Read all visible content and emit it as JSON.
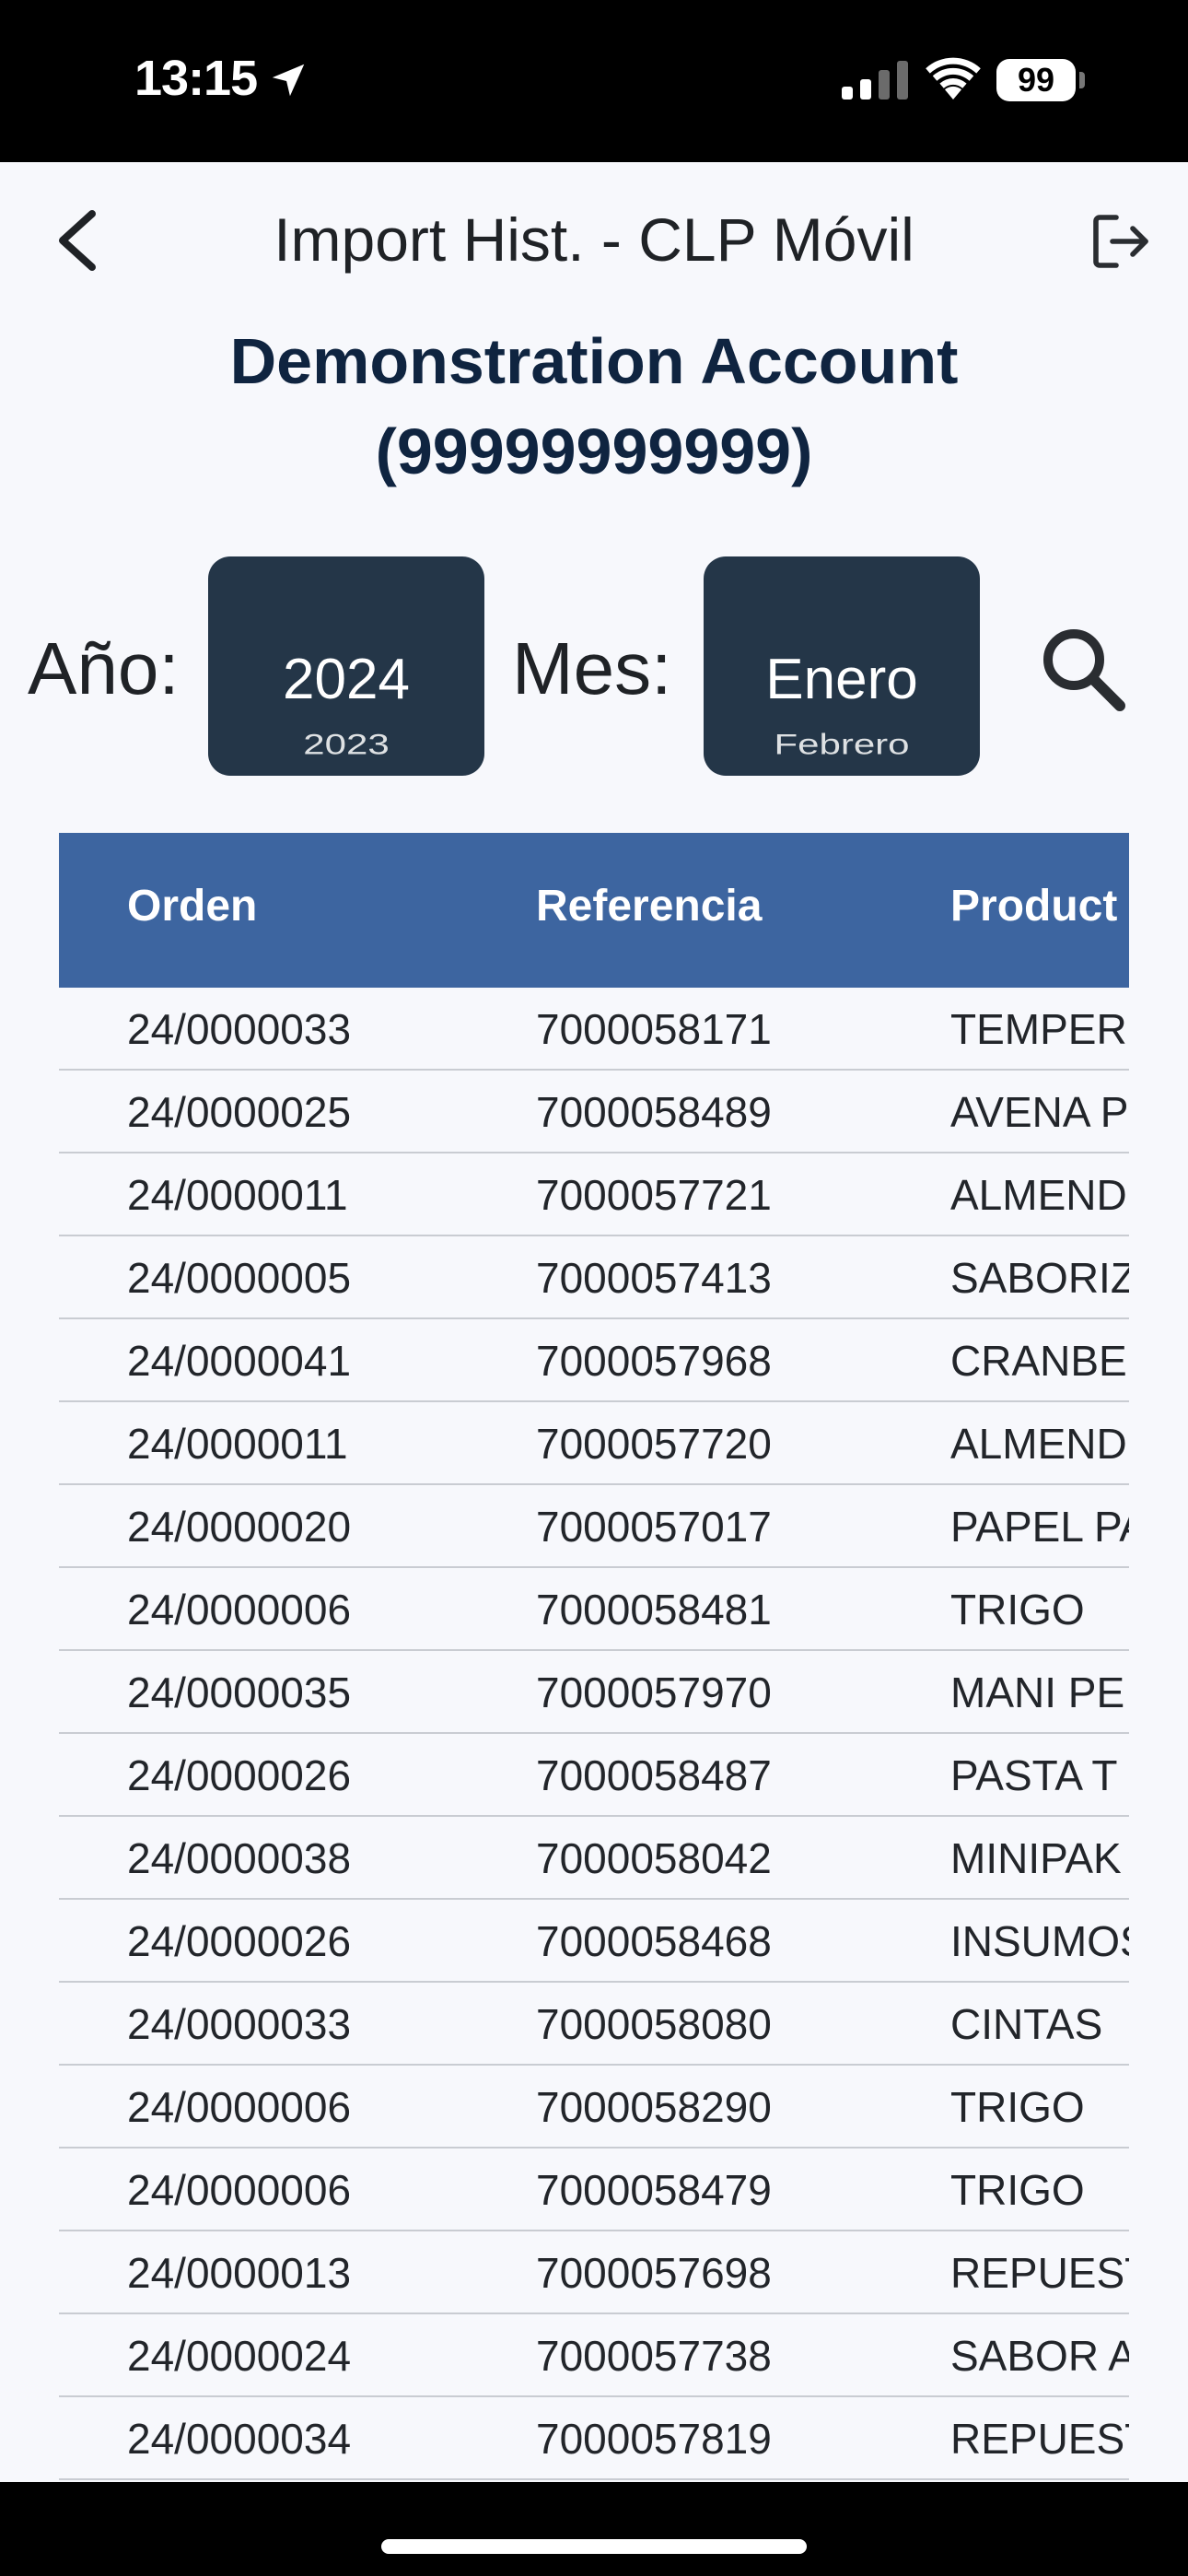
{
  "status_bar": {
    "time": "13:15",
    "battery": "99"
  },
  "header": {
    "title": "Import Hist. - CLP Móvil"
  },
  "account": {
    "name": "Demonstration Account",
    "id": "(99999999999)"
  },
  "filters": {
    "year_label": "Año:",
    "year_selected": "2024",
    "year_next": "2023",
    "month_label": "Mes:",
    "month_selected": "Enero",
    "month_next": "Febrero"
  },
  "table": {
    "columns": [
      "Orden",
      "Referencia",
      "Product"
    ],
    "rows": [
      [
        "24/0000033",
        "7000058171",
        "TEMPER"
      ],
      [
        "24/0000025",
        "7000058489",
        "AVENA P"
      ],
      [
        "24/0000011",
        "7000057721",
        "ALMEND"
      ],
      [
        "24/0000005",
        "7000057413",
        "SABORIZ"
      ],
      [
        "24/0000041",
        "7000057968",
        "CRANBE"
      ],
      [
        "24/0000011",
        "7000057720",
        "ALMEND"
      ],
      [
        "24/0000020",
        "7000057017",
        "PAPEL PA"
      ],
      [
        "24/0000006",
        "7000058481",
        "TRIGO"
      ],
      [
        "24/0000035",
        "7000057970",
        "MANI PE"
      ],
      [
        "24/0000026",
        "7000058487",
        "PASTA T"
      ],
      [
        "24/0000038",
        "7000058042",
        "MINIPAK"
      ],
      [
        "24/0000026",
        "7000058468",
        "INSUMOS"
      ],
      [
        "24/0000033",
        "7000058080",
        "CINTAS"
      ],
      [
        "24/0000006",
        "7000058290",
        "TRIGO"
      ],
      [
        "24/0000006",
        "7000058479",
        "TRIGO"
      ],
      [
        "24/0000013",
        "7000057698",
        "REPUEST"
      ],
      [
        "24/0000024",
        "7000057738",
        "SABOR A"
      ],
      [
        "24/0000034",
        "7000057819",
        "REPUEST"
      ]
    ]
  },
  "icons": {
    "back": "chevron-left-icon",
    "logout": "logout-icon",
    "search": "search-icon",
    "location": "location-arrow-icon",
    "signal": "cellular-signal-icon",
    "wifi": "wifi-icon"
  },
  "colors": {
    "table_header": "#3d65a0",
    "picker": "#243648",
    "account_text": "#0f2440"
  }
}
